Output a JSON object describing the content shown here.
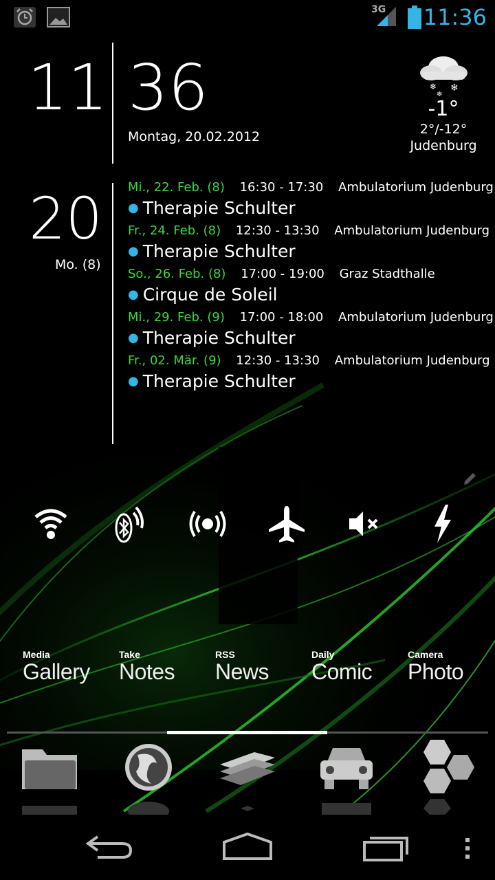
{
  "status_bar": {
    "time": "11:36",
    "network": "3G",
    "icons": [
      "alarm-icon",
      "gallery-notification-icon",
      "signal-icon",
      "battery-icon"
    ]
  },
  "clock": {
    "hour": "11",
    "minute": "36",
    "date": "Montag, 20.02.2012"
  },
  "weather": {
    "icon": "snow-cloud-icon",
    "temp": "-1°",
    "range": "2°/-12°",
    "city": "Judenburg"
  },
  "calendar": {
    "day": "20",
    "weekday": "Mo. (8)",
    "events": [
      {
        "date": "Mi., 22. Feb. (8)",
        "time": "16:30 - 17:30",
        "location": "Ambulatorium Judenburg",
        "title": "Therapie Schulter"
      },
      {
        "date": "Fr., 24. Feb. (8)",
        "time": "12:30 - 13:30",
        "location": "Ambulatorium Judenburg",
        "title": "Therapie Schulter"
      },
      {
        "date": "So., 26. Feb. (8)",
        "time": "17:00 - 19:00",
        "location": "Graz Stadthalle",
        "title": "Cirque de Soleil"
      },
      {
        "date": "Mi., 29. Feb. (9)",
        "time": "17:00 - 18:00",
        "location": "Ambulatorium Judenburg",
        "title": "Therapie Schulter"
      },
      {
        "date": "Fr., 02. Mär. (9)",
        "time": "12:30 - 13:30",
        "location": "Ambulatorium Judenburg",
        "title": "Therapie Schulter"
      }
    ]
  },
  "toggles": [
    "wifi-icon",
    "bluetooth-icon",
    "hotspot-icon",
    "airplane-icon",
    "mute-icon",
    "flash-icon"
  ],
  "shortcuts": [
    {
      "small": "Media",
      "big": "Gallery"
    },
    {
      "small": "Take",
      "big": "Notes"
    },
    {
      "small": "RSS",
      "big": "News"
    },
    {
      "small": "Daily",
      "big": "Comic"
    },
    {
      "small": "Camera",
      "big": "Photo"
    }
  ],
  "dock": [
    "folder-icon",
    "globe-icon",
    "bank-icon",
    "car-icon",
    "hexagons-icon"
  ],
  "navigation": [
    "back-icon",
    "home-icon",
    "recents-icon",
    "menu-icon"
  ],
  "colors": {
    "accent_blue": "#33b5e5",
    "event_date_green": "#3ad93a",
    "background": "#000000"
  }
}
